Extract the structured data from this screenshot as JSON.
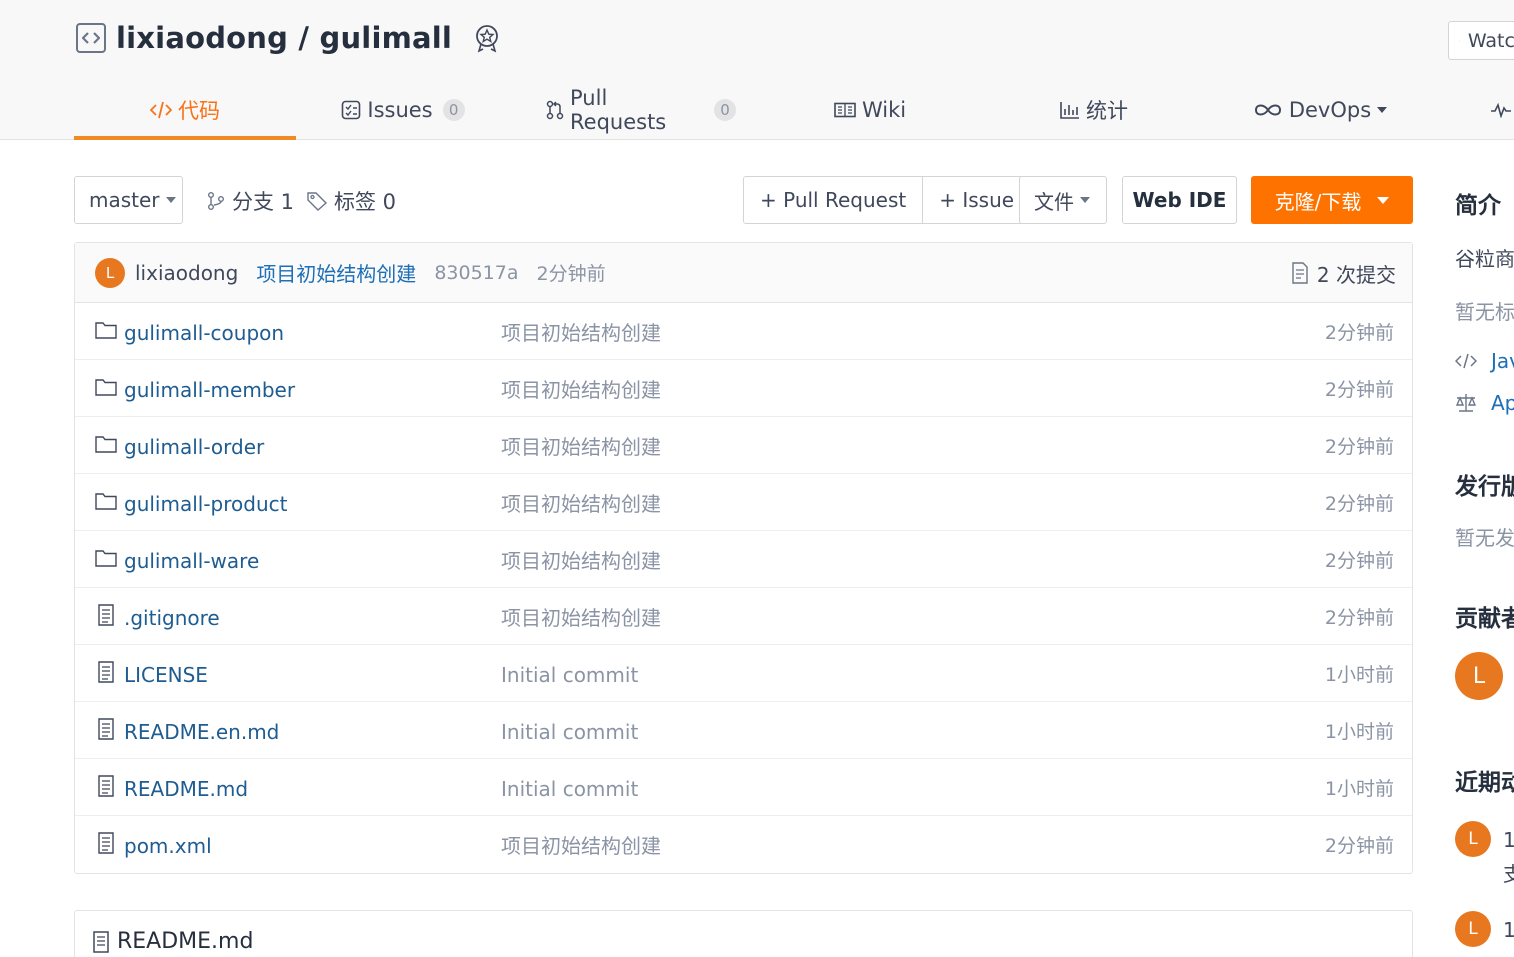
{
  "repo": {
    "owner": "lixiaodong",
    "separator": "/",
    "name": "gulimall",
    "watch_label": "Watch"
  },
  "tabs": [
    {
      "label": "代码",
      "icon": "code-icon",
      "active": true
    },
    {
      "label": "Issues",
      "icon": "issues-icon",
      "count": "0"
    },
    {
      "label": "Pull Requests",
      "icon": "pull-request-icon",
      "count": "0"
    },
    {
      "label": "Wiki",
      "icon": "wiki-icon"
    },
    {
      "label": "统计",
      "icon": "stats-icon"
    },
    {
      "label": "DevOps",
      "icon": "devops-icon"
    }
  ],
  "toolbar": {
    "branch": "master",
    "branches_label": "分支 1",
    "tags_label": "标签 0",
    "pull_request_btn": "+ Pull Request",
    "issue_btn": "+ Issue",
    "file_btn": "文件",
    "webide_btn": "Web IDE",
    "clone_btn": "克隆/下载"
  },
  "last_commit": {
    "avatar_letter": "L",
    "author": "lixiaodong",
    "message": "项目初始结构创建",
    "sha": "830517a",
    "time": "2分钟前",
    "commit_count": "2 次提交"
  },
  "files": [
    {
      "type": "folder",
      "name": "gulimall-coupon",
      "message": "项目初始结构创建",
      "time": "2分钟前"
    },
    {
      "type": "folder",
      "name": "gulimall-member",
      "message": "项目初始结构创建",
      "time": "2分钟前"
    },
    {
      "type": "folder",
      "name": "gulimall-order",
      "message": "项目初始结构创建",
      "time": "2分钟前"
    },
    {
      "type": "folder",
      "name": "gulimall-product",
      "message": "项目初始结构创建",
      "time": "2分钟前"
    },
    {
      "type": "folder",
      "name": "gulimall-ware",
      "message": "项目初始结构创建",
      "time": "2分钟前"
    },
    {
      "type": "file",
      "name": ".gitignore",
      "message": "项目初始结构创建",
      "time": "2分钟前"
    },
    {
      "type": "file",
      "name": "LICENSE",
      "message": "Initial commit",
      "time": "1小时前"
    },
    {
      "type": "file",
      "name": "README.en.md",
      "message": "Initial commit",
      "time": "1小时前"
    },
    {
      "type": "file",
      "name": "README.md",
      "message": "Initial commit",
      "time": "1小时前"
    },
    {
      "type": "file",
      "name": "pom.xml",
      "message": "项目初始结构创建",
      "time": "2分钟前"
    }
  ],
  "readme": {
    "title": "README.md"
  },
  "sidebar": {
    "intro_heading": "简介",
    "intro_text": "谷粒商",
    "no_tags_text": "暂无标",
    "language": "Jav",
    "license": "Ap",
    "release_heading": "发行版",
    "no_release_text": "暂无发",
    "contrib_heading": "贡献者",
    "contrib_avatar": "L",
    "activity_heading": "近期动",
    "activity": [
      {
        "avatar": "L",
        "line1": "1",
        "line2": "支"
      },
      {
        "avatar": "L",
        "line1": "1"
      }
    ]
  },
  "colors": {
    "accent": "#fe7300",
    "active_tab": "#f97316",
    "link": "#1e5c91",
    "avatar": "#e8781f"
  }
}
